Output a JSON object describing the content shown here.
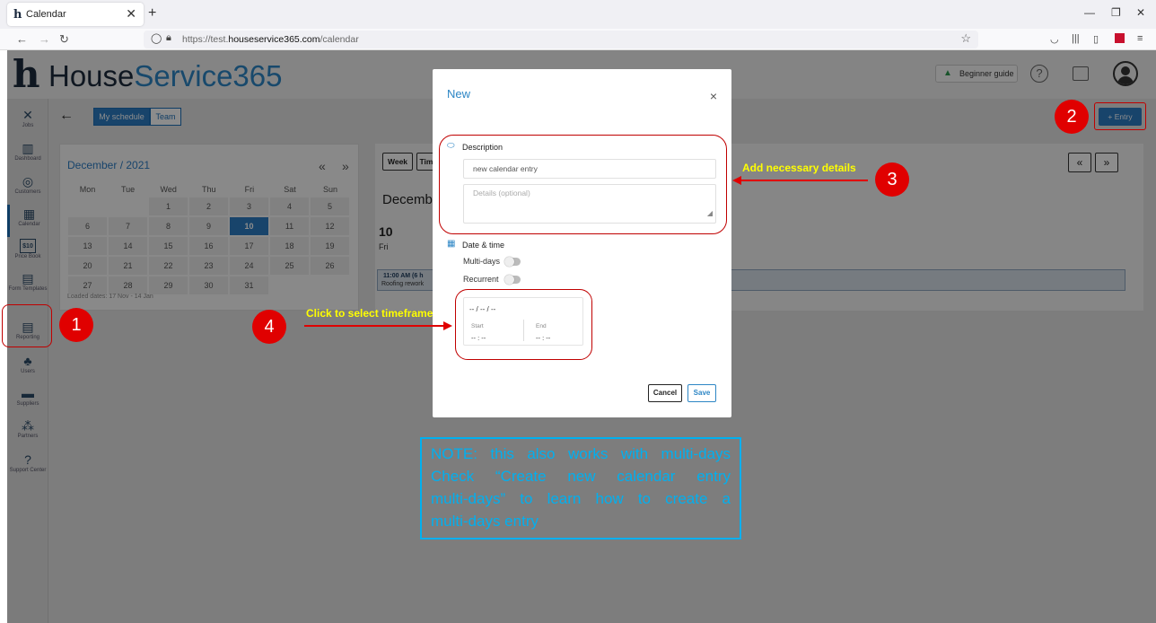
{
  "browser": {
    "tab_title": "Calendar",
    "favicon": "h",
    "url_prefix": "https://test.",
    "url_domain": "houseservice365.com",
    "url_path": "/calendar"
  },
  "app": {
    "logo_letter": "h",
    "logo_part1": "House",
    "logo_part2": "Service365",
    "beginner_guide": "Beginner guide",
    "help": "?"
  },
  "sidebar": {
    "items": [
      {
        "icon": "tools-icon",
        "glyph": "✕",
        "label": "Jobs"
      },
      {
        "icon": "dashboard-icon",
        "glyph": "▥",
        "label": "Dashboard"
      },
      {
        "icon": "customers-icon",
        "glyph": "◎",
        "label": "Customers"
      },
      {
        "icon": "calendar-icon",
        "glyph": "▦",
        "label": "Calendar"
      },
      {
        "icon": "price-book-icon",
        "glyph": "$10",
        "label": "Price Book"
      },
      {
        "icon": "form-templates-icon",
        "glyph": "▤",
        "label": "Form Templates"
      },
      {
        "icon": "reporting-icon",
        "glyph": "▤",
        "label": "Reporting"
      },
      {
        "icon": "users-icon",
        "glyph": "♣",
        "label": "Users"
      },
      {
        "icon": "suppliers-icon",
        "glyph": "▬",
        "label": "Suppliers"
      },
      {
        "icon": "partners-icon",
        "glyph": "⁂",
        "label": "Partners"
      },
      {
        "icon": "support-icon",
        "glyph": "?",
        "label": "Support Center"
      }
    ]
  },
  "toolbar": {
    "my_schedule": "My schedule",
    "team": "Team",
    "entry": "+ Entry"
  },
  "mini_calendar": {
    "title": "December / 2021",
    "prev": "«",
    "next": "»",
    "weekdays": [
      "Mon",
      "Tue",
      "Wed",
      "Thu",
      "Fri",
      "Sat",
      "Sun"
    ],
    "weeks": [
      [
        "",
        "",
        "1",
        "2",
        "3",
        "4",
        "5"
      ],
      [
        "6",
        "7",
        "8",
        "9",
        "10",
        "11",
        "12"
      ],
      [
        "13",
        "14",
        "15",
        "16",
        "17",
        "18",
        "19"
      ],
      [
        "20",
        "21",
        "22",
        "23",
        "24",
        "25",
        "26"
      ],
      [
        "27",
        "28",
        "29",
        "30",
        "31",
        "",
        ""
      ]
    ],
    "today": "10",
    "loaded_dates": "Loaded dates: 17 Nov - 14 Jan"
  },
  "main_calendar": {
    "week_btn": "Week",
    "tim_btn": "Tim",
    "month_header": "Decembe",
    "day_number": "10",
    "day_name": "Fri",
    "event_time": "11:00 AM (6 h",
    "event_name": "Roofing rework",
    "prev": "«",
    "next": "»"
  },
  "modal": {
    "title": "New",
    "close": "×",
    "description_label": "Description",
    "description_value": "new calendar entry",
    "details_placeholder": "Details (optional)",
    "datetime_label": "Date & time",
    "multidays_label": "Multi-days",
    "recurrent_label": "Recurrent",
    "date_placeholder": "-- / -- / --",
    "start_label": "Start",
    "end_label": "End",
    "start_value": "-- : --",
    "end_value": "-- : --",
    "cancel": "Cancel",
    "save": "Save"
  },
  "annotations": {
    "step1": "1",
    "step2": "2",
    "step3": "3",
    "step4": "4",
    "callout3": "Add necessary details",
    "callout4": "Click to select timeframe",
    "note_lines": [
      "NOTE: this also works with multi-days",
      "Check “Create new calendar entry",
      "multi-days” to learn how to create a",
      "multi-days entry"
    ],
    "color_red": "#e00000",
    "color_callout": "#ffff00",
    "color_note": "#00b0f0"
  }
}
